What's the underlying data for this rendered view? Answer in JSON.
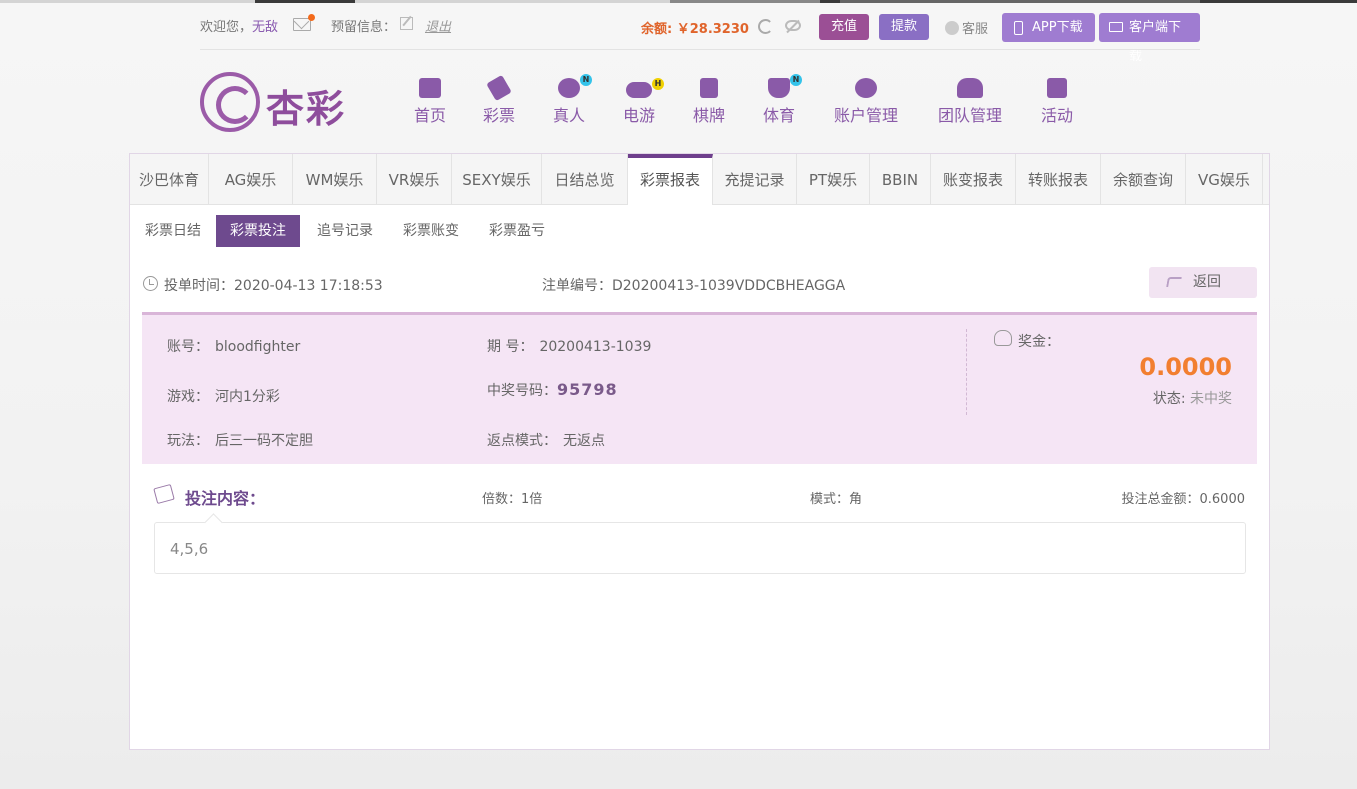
{
  "topbar": {
    "welcome": "欢迎您，",
    "username": "无敌",
    "reserve_info": "预留信息：",
    "logout": "退出",
    "balance": "余额: ￥28.3230",
    "recharge": "充值",
    "withdraw": "提款",
    "service": "客服",
    "app_download": "APP下载",
    "client_download": "客户端下载"
  },
  "logo": {
    "text": "杏彩"
  },
  "nav": [
    {
      "label": "首页",
      "icon": "home-icon"
    },
    {
      "label": "彩票",
      "icon": "ticket-icon"
    },
    {
      "label": "真人",
      "icon": "dealer-icon",
      "badge": "N"
    },
    {
      "label": "电游",
      "icon": "gamepad-icon",
      "badge": "H"
    },
    {
      "label": "棋牌",
      "icon": "cards-icon"
    },
    {
      "label": "体育",
      "icon": "trophy-icon",
      "badge": "N"
    },
    {
      "label": "账户管理",
      "icon": "yen-coin-icon"
    },
    {
      "label": "团队管理",
      "icon": "team-icon"
    },
    {
      "label": "活动",
      "icon": "gift-icon"
    }
  ],
  "tabs": [
    "沙巴体育",
    "AG娱乐",
    "WM娱乐",
    "VR娱乐",
    "SEXY娱乐",
    "日结总览",
    "彩票报表",
    "充提记录",
    "PT娱乐",
    "BBIN",
    "账变报表",
    "转账报表",
    "余额查询",
    "VG娱乐"
  ],
  "active_tab": "彩票报表",
  "subtabs": [
    "彩票日结",
    "彩票投注",
    "追号记录",
    "彩票账变",
    "彩票盈亏"
  ],
  "active_subtab": "彩票投注",
  "detail": {
    "bet_time_label": "投单时间：2020-04-13 17:18:53",
    "order_no_label": "注单编号：D20200413-1039VDDCBHEAGGA",
    "back": "返回",
    "account_label": "账号：",
    "account": "bloodfighter",
    "period_label": "期 号：",
    "period": "20200413-1039",
    "game_label": "游戏：",
    "game": "河内1分彩",
    "winning_label": "中奖号码：",
    "winning": "95798",
    "play_label": "玩法：",
    "play": "后三一码不定胆",
    "rebate_label": "返点模式：",
    "rebate": "无返点",
    "prize_label": "奖金：",
    "prize": "0.0000",
    "status_label": "状态:",
    "status": "未中奖"
  },
  "content": {
    "title": "投注内容：",
    "multiplier": "倍数：1倍",
    "mode": "模式：角",
    "total": "投注总金额：0.6000",
    "numbers": "4,5,6"
  },
  "colors": {
    "brand": "#6e4a8e",
    "accent": "#f27f30",
    "card_bg": "#f5e5f5"
  }
}
